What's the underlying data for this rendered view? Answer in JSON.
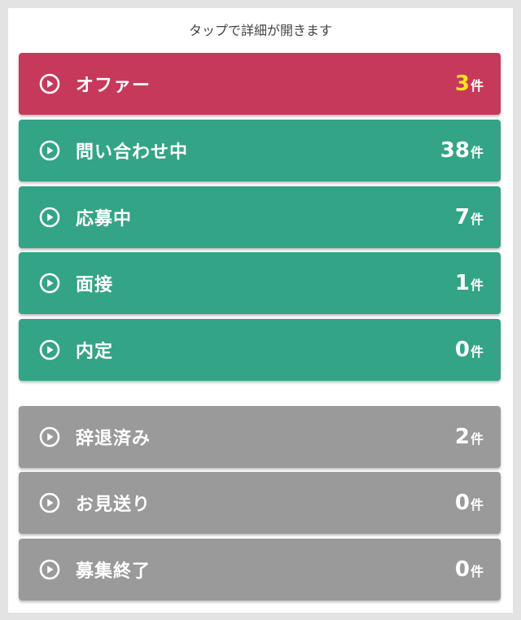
{
  "header": {
    "hint": "タップで詳細が開きます"
  },
  "colors": {
    "offer": "#c6395a",
    "active": "#33a486",
    "inactive": "#9a9a9a",
    "highlight_count": "#ffe319"
  },
  "unit": "件",
  "active_items": [
    {
      "label": "オファー",
      "count": "3",
      "color": "offer",
      "highlight": true,
      "icon": "play-circle-icon"
    },
    {
      "label": "問い合わせ中",
      "count": "38",
      "color": "active",
      "icon": "play-circle-icon"
    },
    {
      "label": "応募中",
      "count": "7",
      "color": "active",
      "icon": "play-circle-icon"
    },
    {
      "label": "面接",
      "count": "1",
      "color": "active",
      "icon": "play-circle-icon"
    },
    {
      "label": "内定",
      "count": "0",
      "color": "active",
      "icon": "play-circle-icon"
    }
  ],
  "inactive_items": [
    {
      "label": "辞退済み",
      "count": "2",
      "color": "inactive",
      "icon": "play-circle-icon"
    },
    {
      "label": "お見送り",
      "count": "0",
      "color": "inactive",
      "icon": "play-circle-icon"
    },
    {
      "label": "募集終了",
      "count": "0",
      "color": "inactive",
      "icon": "play-circle-icon"
    }
  ]
}
